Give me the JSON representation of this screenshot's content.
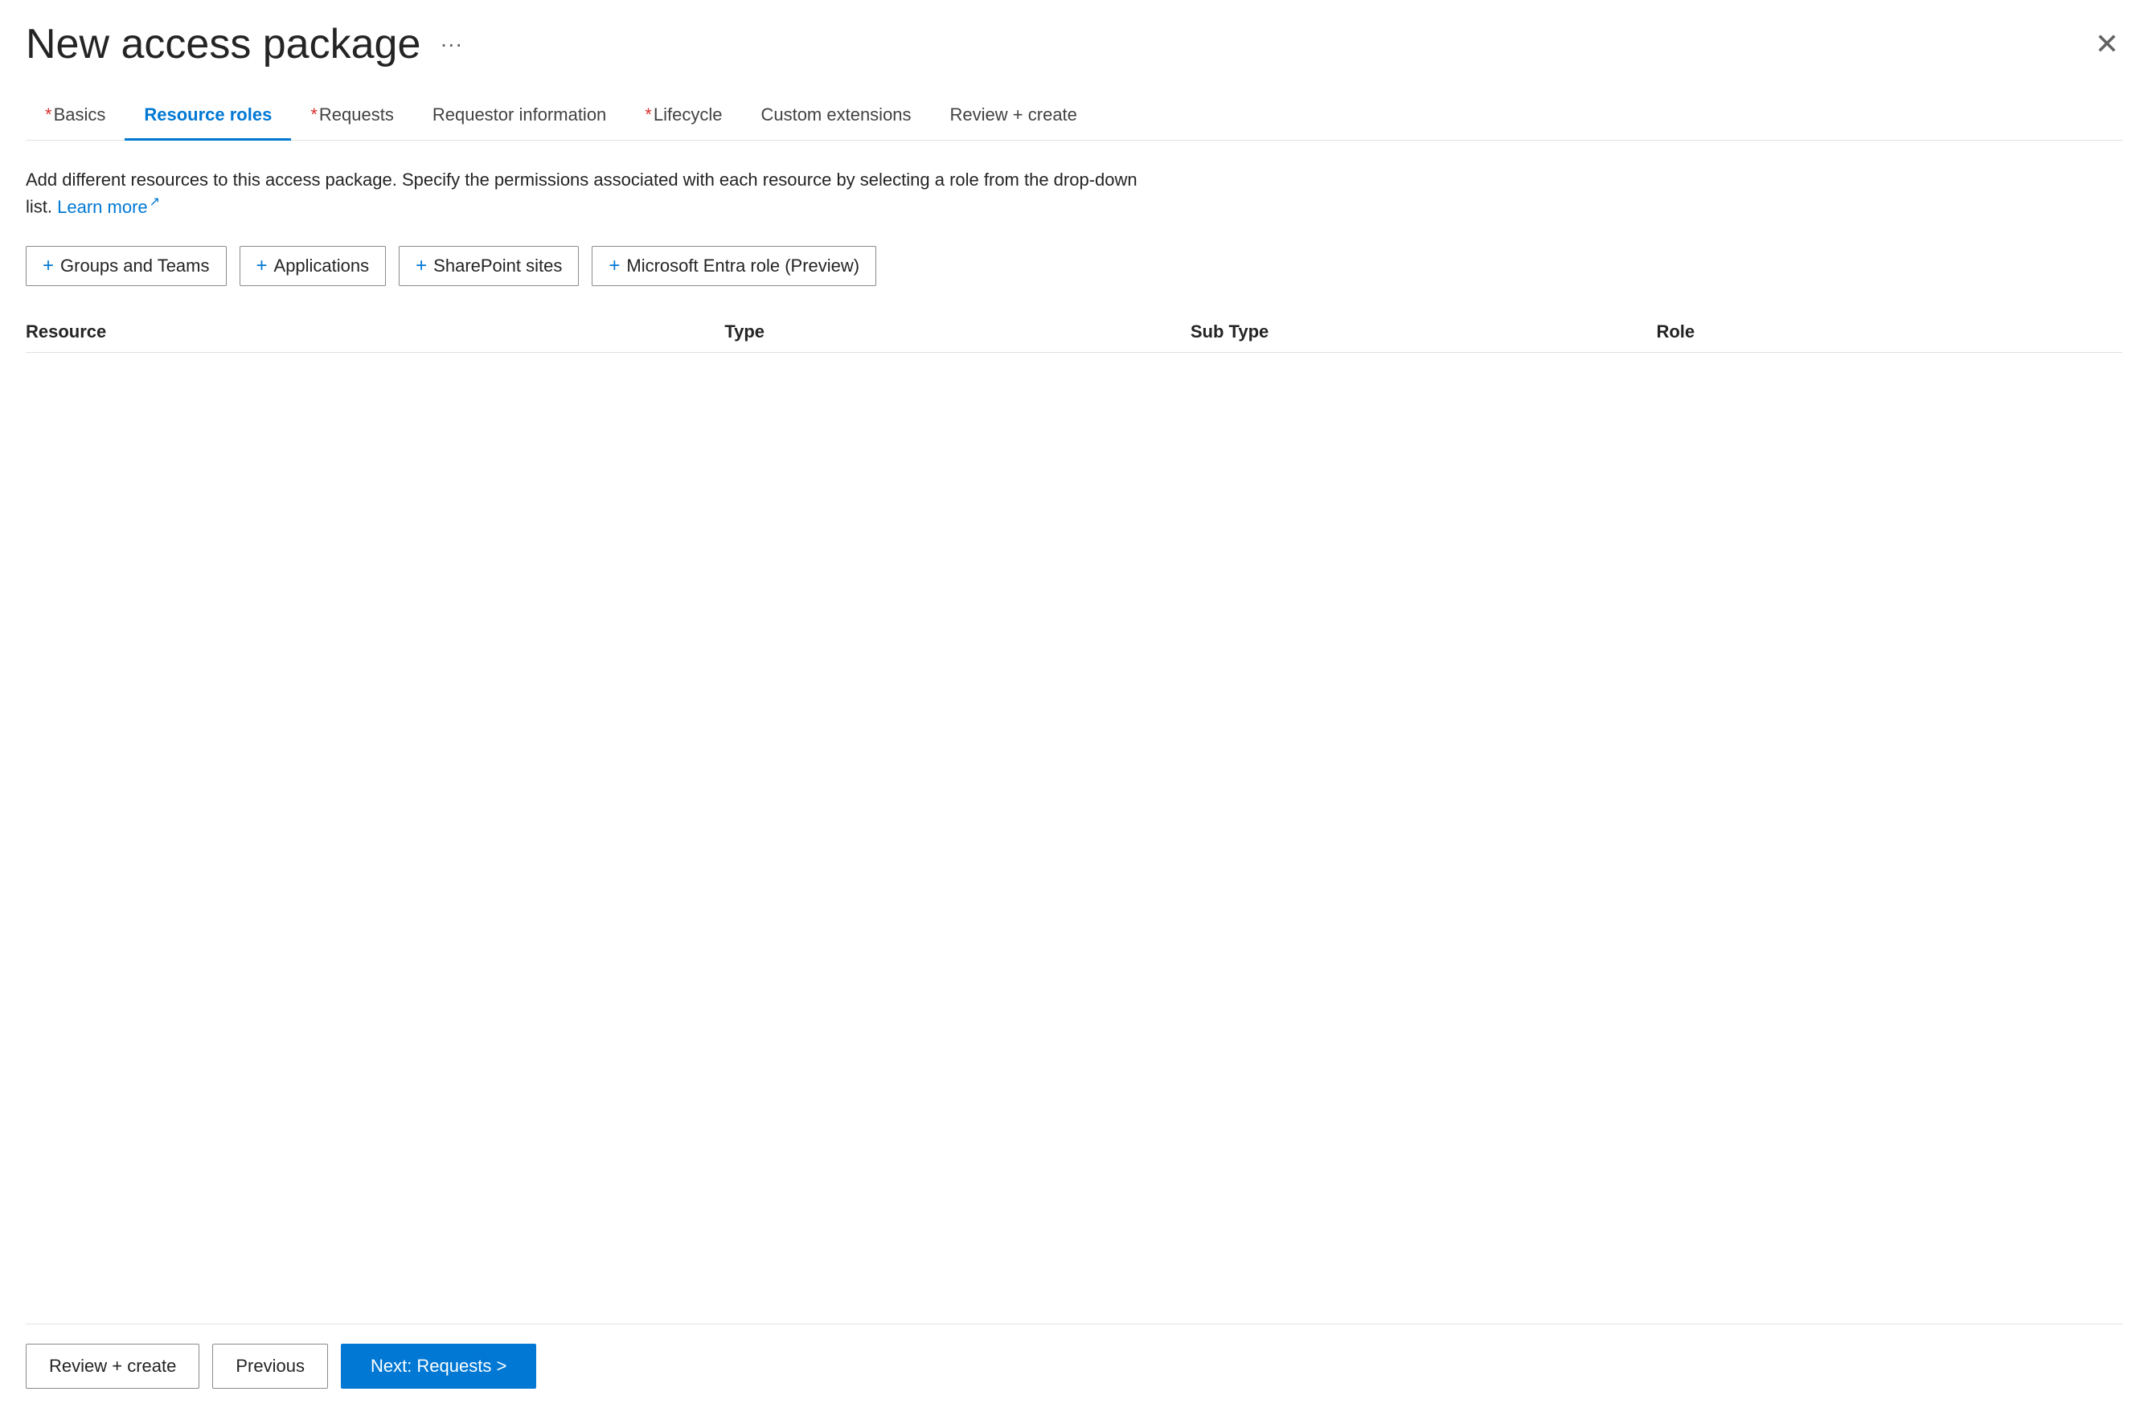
{
  "page": {
    "title": "New access package",
    "more_options_label": "···",
    "close_label": "✕"
  },
  "tabs": [
    {
      "id": "basics",
      "label": "Basics",
      "required": true,
      "active": false
    },
    {
      "id": "resource-roles",
      "label": "Resource roles",
      "required": false,
      "active": true
    },
    {
      "id": "requests",
      "label": "Requests",
      "required": true,
      "active": false
    },
    {
      "id": "requestor-information",
      "label": "Requestor information",
      "required": false,
      "active": false
    },
    {
      "id": "lifecycle",
      "label": "Lifecycle",
      "required": true,
      "active": false
    },
    {
      "id": "custom-extensions",
      "label": "Custom extensions",
      "required": false,
      "active": false
    },
    {
      "id": "review-create",
      "label": "Review + create",
      "required": false,
      "active": false
    }
  ],
  "description": {
    "text": "Add different resources to this access package. Specify the permissions associated with each resource by selecting a role from the drop-down list.",
    "learn_more_label": "Learn more",
    "external_icon": "↗"
  },
  "action_buttons": [
    {
      "id": "groups-teams",
      "label": "Groups and Teams"
    },
    {
      "id": "applications",
      "label": "Applications"
    },
    {
      "id": "sharepoint-sites",
      "label": "SharePoint sites"
    },
    {
      "id": "microsoft-entra-role",
      "label": "Microsoft Entra role (Preview)"
    }
  ],
  "table": {
    "headers": [
      {
        "id": "resource",
        "label": "Resource"
      },
      {
        "id": "type",
        "label": "Type"
      },
      {
        "id": "sub-type",
        "label": "Sub Type"
      },
      {
        "id": "role",
        "label": "Role"
      }
    ],
    "rows": []
  },
  "footer": {
    "review_create_label": "Review + create",
    "previous_label": "Previous",
    "next_label": "Next: Requests >"
  }
}
